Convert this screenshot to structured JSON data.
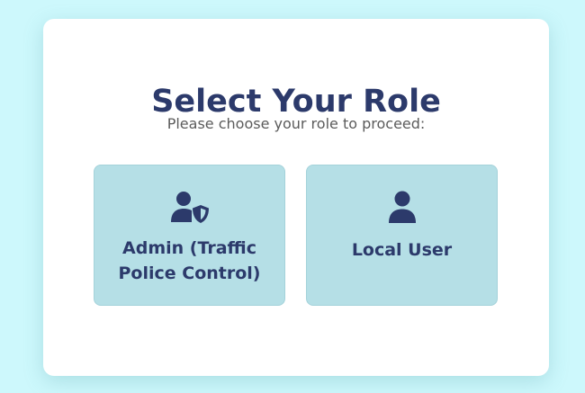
{
  "title": "Select Your Role",
  "subtitle": "Please choose your role to proceed:",
  "roles": [
    {
      "label": "Admin (Traffic Police Control)",
      "icon": "user-shield-icon"
    },
    {
      "label": "Local User",
      "icon": "user-icon"
    }
  ],
  "colors": {
    "page_background": "#cdf8fc",
    "card_background": "#ffffff",
    "role_card_background": "#b5dfe6",
    "accent_text": "#2c3a6b",
    "subtitle_text": "#5b5b5b"
  }
}
